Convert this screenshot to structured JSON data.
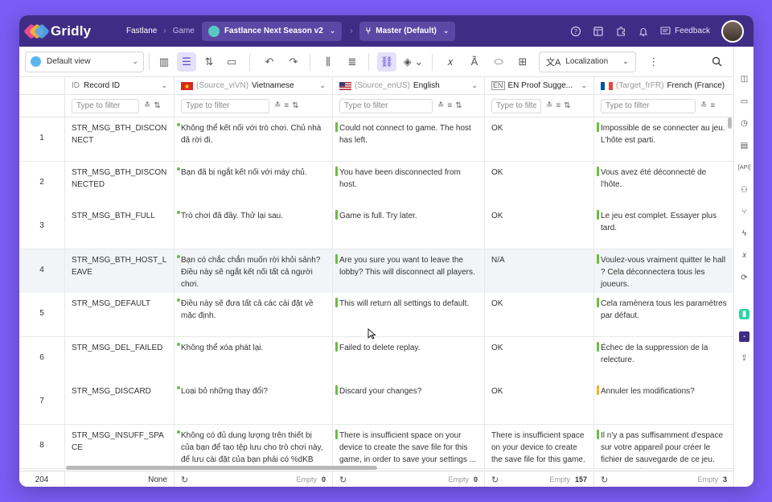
{
  "app": {
    "name": "Gridly",
    "breadcrumb": [
      "Fastlane",
      "Game"
    ],
    "project": "Fastlance Next Season v2",
    "branch": "Master (Default)",
    "feedback": "Feedback",
    "colors": {
      "topbar": "#3f2d85",
      "accent": "#5b45c7",
      "background": "#7b5cf5"
    }
  },
  "toolbar": {
    "view": "Default view",
    "localization": "Localization",
    "icons": [
      "grid-view-icon",
      "filter-icon",
      "sort-icon",
      "folder-icon",
      "undo-icon",
      "redo-icon",
      "columns-icon",
      "rows-icon",
      "link-icon",
      "fill-color-icon",
      "formula-icon",
      "spellcheck-icon",
      "tag-icon",
      "layout-icon",
      "translate-icon",
      "more-icon",
      "search-icon"
    ]
  },
  "grid": {
    "filter_placeholder": "Type to filter",
    "columns": [
      {
        "id": "record_id",
        "type_label": "ID",
        "source": "",
        "name": "Record ID",
        "flag": ""
      },
      {
        "id": "vi",
        "type_label": "",
        "source": "(Source_viVN)",
        "name": "Vietnamese",
        "flag": "vn"
      },
      {
        "id": "en",
        "type_label": "",
        "source": "(Source_enUS)",
        "name": "English",
        "flag": "us"
      },
      {
        "id": "proof",
        "type_label": "EN",
        "source": "",
        "name": "EN Proof Sugge...",
        "flag": ""
      },
      {
        "id": "fr",
        "type_label": "",
        "source": "(Target_frFR)",
        "name": "French (France)",
        "flag": "fr"
      }
    ],
    "rows": [
      {
        "num": "1",
        "id": "STR_MSG_BTH_DISCONNECT",
        "vi": "Không thể kết nối với trò chơi. Chủ nhà đã rời đi.",
        "en": "Could not connect to game. The host has left.",
        "proof": "OK",
        "fr": "Impossible de se connecter au jeu. L'hôte est parti."
      },
      {
        "num": "2",
        "id": "STR_MSG_BTH_DISCONNECTED",
        "vi": "Bạn đã bị ngắt kết nối với máy chủ.",
        "en": "You have been disconnected from host.",
        "proof": "OK",
        "fr": "Vous avez été déconnecté de l'hôte."
      },
      {
        "num": "3",
        "id": "STR_MSG_BTH_FULL",
        "vi": "Trò chơi đã đầy. Thử lại sau.",
        "en": "Game is full. Try later.",
        "proof": "OK",
        "fr": "Le jeu est complet. Essayer plus tard."
      },
      {
        "num": "4",
        "id": "STR_MSG_BTH_HOST_LEAVE",
        "vi": "Bạn có chắc chắn muốn rời khỏi sảnh? Điều này sẽ ngắt kết nối tất cả người chơi.",
        "en": "Are you sure you want to leave the lobby? This will disconnect all players.",
        "proof": "N/A",
        "fr": "Voulez-vous vraiment quitter le hall ? Cela déconnectera tous les joueurs."
      },
      {
        "num": "5",
        "id": "STR_MSG_DEFAULT",
        "vi": "Điều này sẽ đưa tất cả các cài đặt về mặc định.",
        "en": "This will return all settings to default.",
        "proof": "OK",
        "fr": "Cela ramènera tous les paramètres par défaut."
      },
      {
        "num": "6",
        "id": "STR_MSG_DEL_FAILED",
        "vi": "Không thể xóa phát lại.",
        "en": "Failed to delete replay.",
        "proof": "OK",
        "fr": "Échec de la suppression de la relecture."
      },
      {
        "num": "7",
        "id": "STR_MSG_DISCARD",
        "vi": "Loại bỏ những thay đổi?",
        "en": "Discard your changes?",
        "proof": "OK",
        "fr": "Annuler les modifications?"
      },
      {
        "num": "8",
        "id": "STR_MSG_INSUFF_SPACE",
        "vi": "Không có đủ dung lượng trên thiết bị của bạn để tạo tệp lưu cho trò chơi này, để lưu cài đặt của bạn phải có %dKB trống. Tiế...",
        "en": "There is insufficient space on your device to create the save file for this game, in order to save your settings ...",
        "proof": "There is insufficient space on your device to create the save file for this game.",
        "fr": "Il n'y a pas suffisamment d'espace sur votre appareil pour créer le fichier de sauvegarde de ce jeu. Pour enregistrer"
      }
    ],
    "footer": {
      "total": "204",
      "id_agg": "None",
      "empty_label": "Empty",
      "vi_empty": "0",
      "en_empty": "0",
      "proof_empty": "157",
      "fr_empty": "3"
    }
  }
}
